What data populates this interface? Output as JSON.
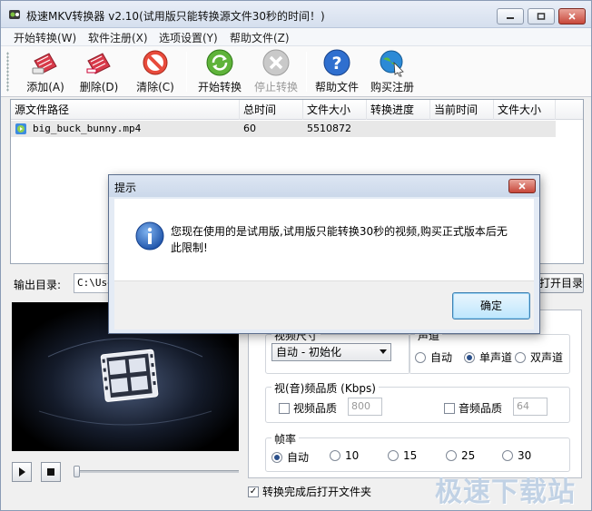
{
  "window": {
    "title": "极速MKV转换器 v2.10(试用版只能转换源文件30秒的时间！)"
  },
  "menu": [
    "开始转换(W)",
    "软件注册(X)",
    "选项设置(Y)",
    "帮助文件(Z)"
  ],
  "toolbar": {
    "add": "添加(A)",
    "delete": "删除(D)",
    "clear": "清除(C)",
    "start": "开始转换",
    "stop": "停止转换",
    "help": "帮助文件",
    "buy": "购买注册"
  },
  "file_list": {
    "columns": [
      "源文件路径",
      "总时间",
      "文件大小",
      "转换进度",
      "当前时间",
      "文件大小"
    ],
    "rows": [
      {
        "path": "big_buck_bunny.mp4",
        "total_time": "60",
        "size": "5510872",
        "progress": "",
        "current_time": "",
        "out_size": ""
      }
    ]
  },
  "output": {
    "label": "输出目录:",
    "value": "C:\\Users",
    "open_button": "打开目录"
  },
  "settings": {
    "video_size_group": "视频尺寸",
    "video_size_value": "自动 - 初始化",
    "channel_group": "声道",
    "channel_options": [
      "自动",
      "单声道",
      "双声道"
    ],
    "channel_selected": "单声道",
    "quality_group": "视(音)频品质 (Kbps)",
    "video_quality_label": "视频品质",
    "video_quality_value": "800",
    "audio_quality_label": "音频品质",
    "audio_quality_value": "64",
    "framerate_group": "帧率",
    "framerate_options": [
      "自动",
      "10",
      "15",
      "25",
      "30"
    ],
    "framerate_selected": "自动",
    "open_folder_after": "转换完成后打开文件夹",
    "open_folder_checked": true
  },
  "dialog": {
    "title": "提示",
    "message": "您现在使用的是试用版,试用版只能转换30秒的视频,购买正式版本后无此限制!",
    "ok": "确定"
  },
  "watermark": "极速下载站"
}
